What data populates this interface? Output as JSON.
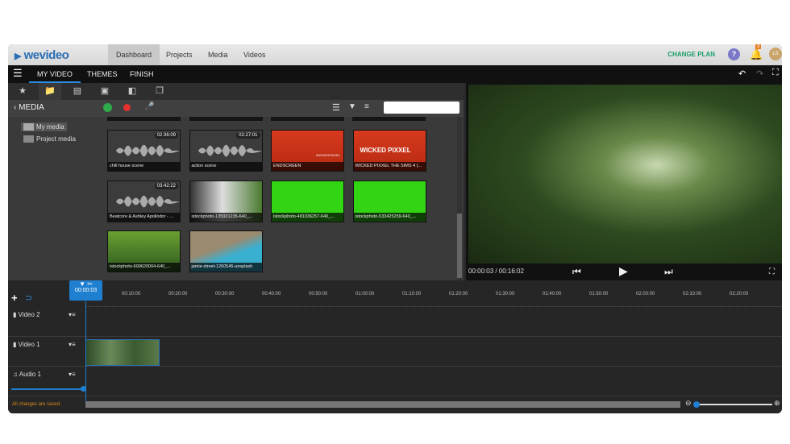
{
  "nav": {
    "logo": "wevideo",
    "tabs": [
      "Dashboard",
      "Projects",
      "Media",
      "Videos"
    ],
    "active": "Dashboard",
    "change_plan": "CHANGE PLAN",
    "help": "?",
    "notifications": "3",
    "avatar": "LS"
  },
  "menu": {
    "tabs": [
      "MY VIDEO",
      "THEMES",
      "FINISH"
    ],
    "active": "MY VIDEO"
  },
  "media": {
    "title": "MEDIA",
    "search_placeholder": "",
    "tree": [
      "My media",
      "Project media"
    ],
    "items": [
      {
        "label": "chill house scene",
        "duration": "02:36:09",
        "type": "audio"
      },
      {
        "label": "action scene",
        "duration": "02:27:01",
        "type": "audio"
      },
      {
        "label": "ENDSCREEN",
        "type": "red",
        "overlay": "WICKEDPIXXEL"
      },
      {
        "label": "WICKED PIXXEL THE SIMS 4 (...",
        "type": "red",
        "overlay": "WICKED PIXXEL"
      },
      {
        "label": "Beatcore & Ashley Apollodor - ...",
        "duration": "03:42:22",
        "type": "audio"
      },
      {
        "label": "istockphoto-135931235-640_...",
        "type": "waterfall"
      },
      {
        "label": "istockphoto-481036257-640_...",
        "type": "green"
      },
      {
        "label": "istockphoto-533425259-640_...",
        "type": "green"
      },
      {
        "label": "istockphoto-699620004-640_...",
        "type": "forest"
      },
      {
        "label": "jamie-street-1260545-unsplash",
        "type": "beach"
      }
    ]
  },
  "preview": {
    "time": "00:00:03 / 00:16:02"
  },
  "timeline": {
    "playhead": "00:00:03",
    "ticks": [
      "00:10:00",
      "00:20:00",
      "00:30:00",
      "00:40:00",
      "00:50:00",
      "01:00:00",
      "01:10:00",
      "01:20:00",
      "01:30:00",
      "01:40:00",
      "01:50:00",
      "02:00:00",
      "02:10:00",
      "02:20:00"
    ],
    "tracks": [
      "Video 2",
      "Video 1",
      "Audio 1"
    ],
    "audio_volume": 1.0,
    "status": "All changes are saved."
  }
}
